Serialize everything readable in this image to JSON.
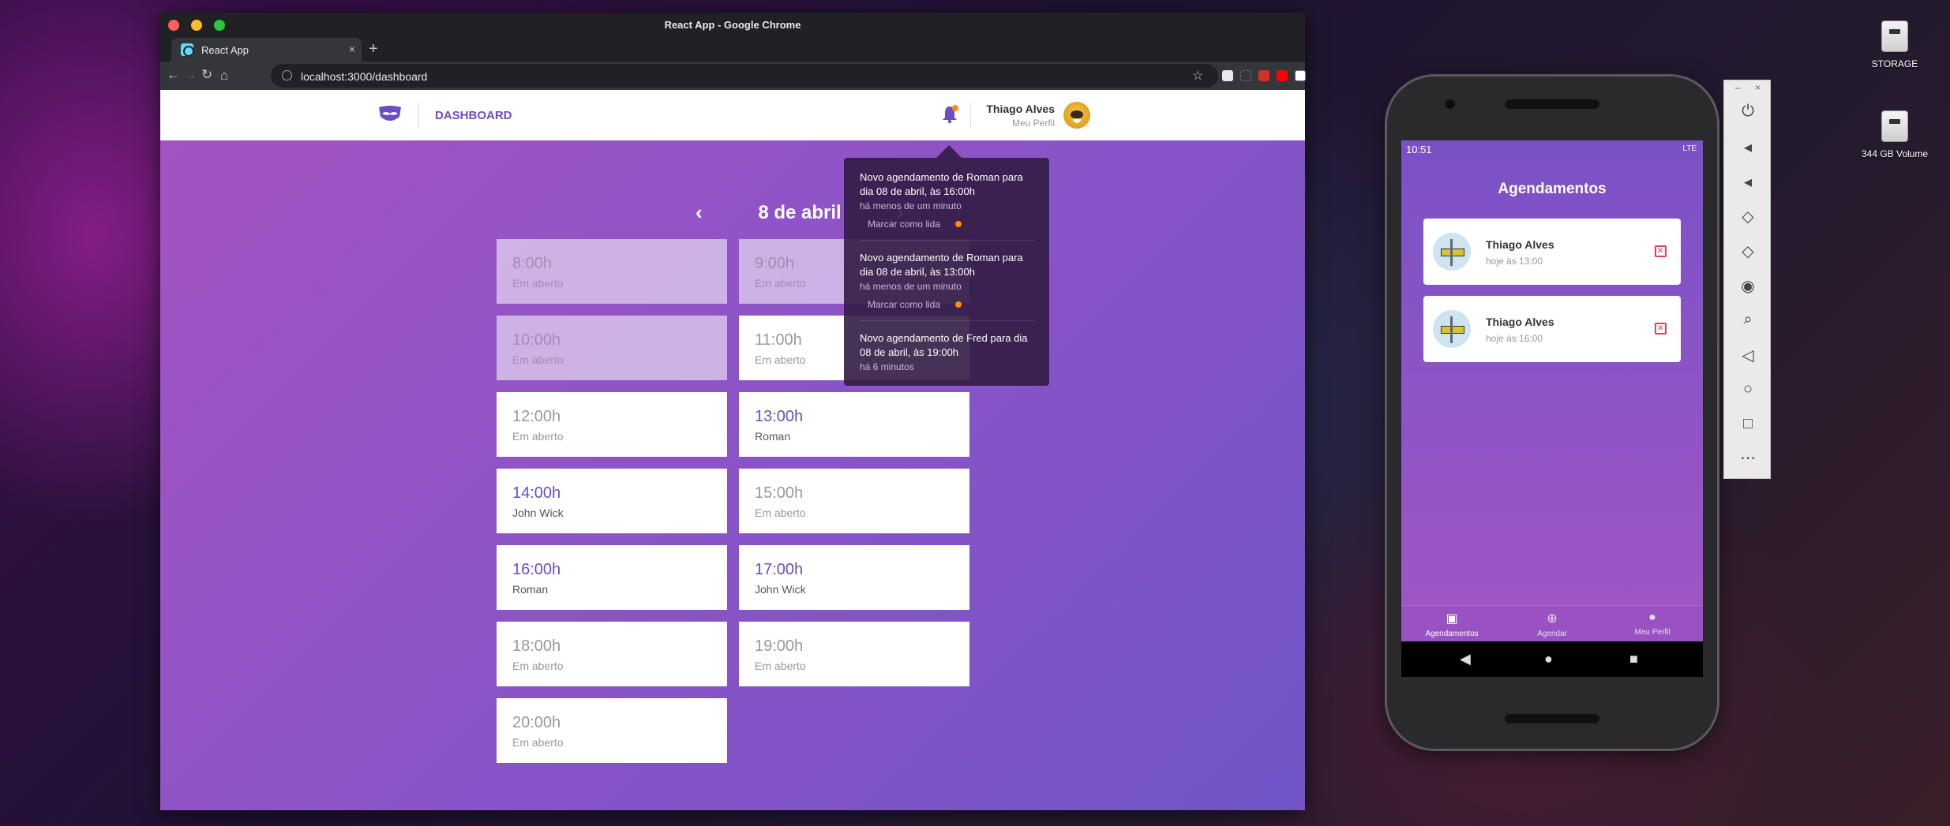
{
  "browser": {
    "window_title": "React App - Google Chrome",
    "tab_title": "React App",
    "tab_close": "×",
    "new_tab": "+",
    "url": "localhost:3000/dashboard"
  },
  "header": {
    "nav_label": "DASHBOARD",
    "user_name": "Thiago Alves",
    "profile_link": "Meu Perfil"
  },
  "schedule": {
    "date_label": "8 de abril",
    "prev_icon": "‹",
    "next_icon": "›",
    "slots": [
      {
        "time": "8:00h",
        "sub": "Em aberto"
      },
      {
        "time": "9:00h",
        "sub": "Em aberto"
      },
      {
        "time": "10:00h",
        "sub": "Em aberto"
      },
      {
        "time": "11:00h",
        "sub": "Em aberto"
      },
      {
        "time": "12:00h",
        "sub": "Em aberto"
      },
      {
        "time": "13:00h",
        "sub": "Roman"
      },
      {
        "time": "14:00h",
        "sub": "John Wick"
      },
      {
        "time": "15:00h",
        "sub": "Em aberto"
      },
      {
        "time": "16:00h",
        "sub": "Roman"
      },
      {
        "time": "17:00h",
        "sub": "John Wick"
      },
      {
        "time": "18:00h",
        "sub": "Em aberto"
      },
      {
        "time": "19:00h",
        "sub": "Em aberto"
      },
      {
        "time": "20:00h",
        "sub": "Em aberto"
      }
    ]
  },
  "notifications": [
    {
      "text": "Novo agendamento de Roman para dia 08 de abril, às 16:00h",
      "time": "há menos de um minuto",
      "mark": "Marcar como lida"
    },
    {
      "text": "Novo agendamento de Roman para dia 08 de abril, às 13:00h",
      "time": "há menos de um minuto",
      "mark": "Marcar como lida"
    },
    {
      "text": "Novo agendamento de Fred para dia 08 de abril, às 19:00h",
      "time": "há 6 minutos"
    }
  ],
  "mobile": {
    "status_time": "10:51",
    "status_right": "LTE",
    "title": "Agendamentos",
    "appointments": [
      {
        "name": "Thiago Alves",
        "time": "hoje às 13:00"
      },
      {
        "name": "Thiago Alves",
        "time": "hoje às 16:00"
      }
    ],
    "tabs": [
      {
        "label": "Agendamentos",
        "icon": "calendar-icon"
      },
      {
        "label": "Agendar",
        "icon": "add-circle-icon"
      },
      {
        "label": "Meu Perfil",
        "icon": "person-icon"
      }
    ]
  },
  "desktop": {
    "icons": [
      {
        "label": "STORAGE"
      },
      {
        "label": "344 GB Volume"
      }
    ]
  },
  "colors": {
    "brand_purple": "#6b4ec2",
    "notification_dot": "#ff9000",
    "cancel_red": "#e0405a"
  }
}
